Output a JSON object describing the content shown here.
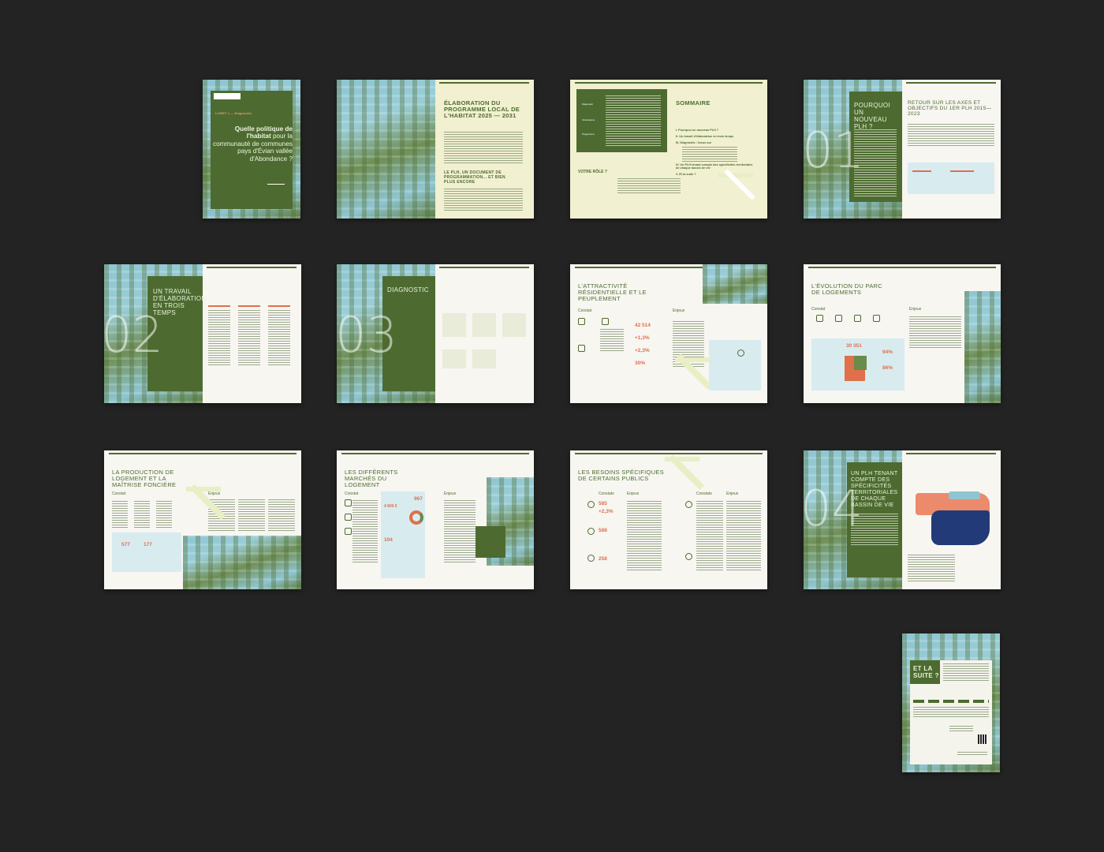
{
  "cover": {
    "livret": "LIVRET 1 — Diagnostic",
    "title_bold": "Quelle politique de l'habitat",
    "title_rest": "pour la communauté de communes pays d'Évian vallée d'Abondance ?"
  },
  "spread1": {
    "title": "ÉLABORATION DU PROGRAMME LOCAL DE L'HABITAT 2025 — 2031",
    "subtitle": "LE PLH, UN DOCUMENT DE PROGRAMMATION... ET BIEN PLUS ENCORE"
  },
  "spread2": {
    "tags": [
      "Diagnostic",
      "Orientations",
      "Programme"
    ],
    "sommaire_title": "SOMMAIRE",
    "items": [
      "I.  Pourquoi un nouveau PLH ?",
      "II.  Un travail d'élaboration en trois temps",
      "III.  Diagnostic : focus sur",
      "IV.  Un PLH tenant compte des spécificités territoriales de chaque bassin de vie",
      "V.  Et la suite ?"
    ],
    "role": "VOTRE RÔLE ?"
  },
  "spread3": {
    "title_left": "POURQUOI UN NOUVEAU PLH ?",
    "num": "01",
    "title_right": "RETOUR SUR LES AXES ET OBJECTIFS DU 1ER PLH 2015—2023"
  },
  "spread4": {
    "num": "02",
    "title": "UN TRAVAIL D'ÉLABORATION EN TROIS TEMPS"
  },
  "spread5": {
    "num": "03",
    "title": "DIAGNOSTIC"
  },
  "spread6": {
    "title": "L'ATTRACTIVITÉ RÉSIDENTIELLE ET LE PEUPLEMENT",
    "constat": "Constat",
    "enjeux": "Enjeux",
    "stats": [
      "42 514",
      "+1,3%",
      "+2,3%",
      "30%"
    ]
  },
  "spread7": {
    "title": "L'ÉVOLUTION DU PARC DE LOGEMENTS",
    "constat": "Constat",
    "enjeux": "Enjeux",
    "stats": [
      "30 351",
      "94%",
      "86%"
    ]
  },
  "spread8": {
    "title": "LA PRODUCTION DE LOGEMENT ET LA MAÎTRISE FONCIÈRE",
    "constat": "Constat",
    "enjeux": "Enjeux",
    "stats": [
      "577",
      "177"
    ]
  },
  "spread9": {
    "title": "LES DIFFÉRENTS MARCHÉS DU LOGEMENT",
    "constat": "Constat",
    "enjeux": "Enjeux",
    "stats": [
      "967",
      "4 800 €",
      "104"
    ]
  },
  "spread10": {
    "title": "LES BESOINS SPÉCIFIQUES DE CERTAINS PUBLICS",
    "constats": "Constats",
    "enjeux": "Enjeux",
    "stats": [
      "585",
      "+2,3%",
      "588",
      "258"
    ]
  },
  "spread11": {
    "num": "04",
    "title": "UN PLH TENANT COMPTE DES SPÉCIFICITÉS TERRITORIALES DE CHAQUE BASSIN DE VIE"
  },
  "final": {
    "title": "ET LA SUITE ?"
  },
  "colors": {
    "green": "#4d6b30",
    "blue": "#8ec5d1",
    "coral": "#e06f4c",
    "cream": "#f1f0d0",
    "background": "#232323"
  }
}
